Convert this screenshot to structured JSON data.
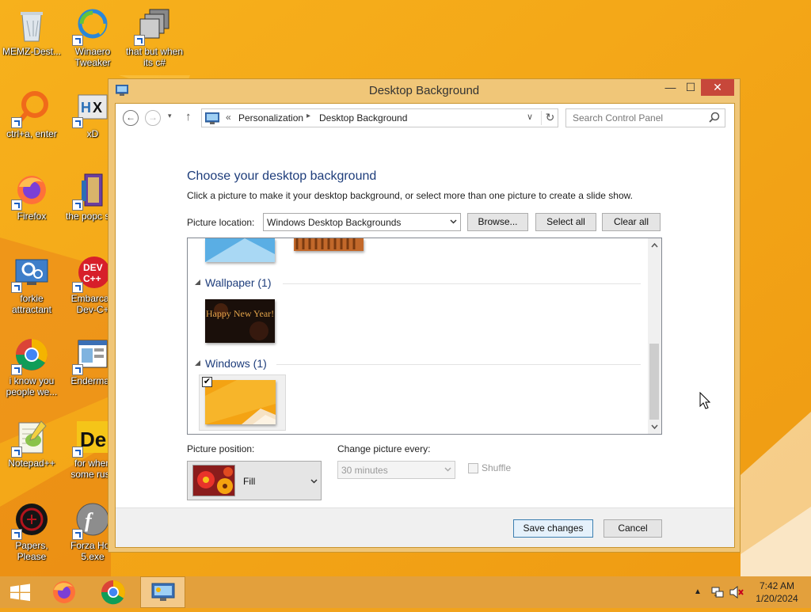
{
  "desktop": {
    "icons": [
      {
        "label": "MEMZ-Dest...",
        "icon": "recycle-bin-icon"
      },
      {
        "label": "Winaero Tweaker",
        "icon": "winaero-icon"
      },
      {
        "label": "that but when its c#",
        "icon": "stacked-windows-icon"
      },
      {
        "label": "ctrl+a, enter",
        "icon": "orange-ring-icon"
      },
      {
        "label": "xD",
        "icon": "hxd-icon"
      },
      {
        "label": "Firefox",
        "icon": "firefox-icon"
      },
      {
        "label": "the popc shit",
        "icon": "winrar-book-icon"
      },
      {
        "label": "forkie attractant",
        "icon": "settings-monitor-icon"
      },
      {
        "label": "Embarcad Dev-C+",
        "icon": "devcpp-icon"
      },
      {
        "label": "i know you people we...",
        "icon": "chrome-icon"
      },
      {
        "label": "Enderman",
        "icon": "window-app-icon"
      },
      {
        "label": "Notepad++",
        "icon": "notepadpp-icon"
      },
      {
        "label": "for when some russ",
        "icon": "de-icon"
      },
      {
        "label": "Papers, Please",
        "icon": "papers-please-icon"
      },
      {
        "label": "Forza Hori 5.exe",
        "icon": "flash-icon"
      }
    ]
  },
  "window": {
    "title": "Desktop Background",
    "controls": {
      "minimize": "—",
      "maximize": "☐",
      "close": "✕"
    },
    "nav": {
      "back": "←",
      "forward": "→",
      "recent": "▾",
      "up": "↑",
      "address_prefix": "«",
      "crumbs": [
        "Personalization",
        "Desktop Background"
      ],
      "crumb_sep": "▸",
      "dropdown": "∨",
      "refresh": "↻",
      "search_placeholder": "Search Control Panel"
    },
    "heading": "Choose your desktop background",
    "subtext": "Click a picture to make it your desktop background, or select more than one picture to create a slide show.",
    "picture_location": {
      "label": "Picture location:",
      "value": "Windows Desktop Backgrounds",
      "buttons": {
        "browse": "Browse...",
        "select_all": "Select all",
        "clear_all": "Clear all"
      }
    },
    "groups": [
      {
        "title": "Wallpaper (1)",
        "thumbs": [
          {
            "text": "Happy New Year!",
            "selected": false
          }
        ]
      },
      {
        "title": "Windows (1)",
        "thumbs": [
          {
            "text": "",
            "selected": true
          }
        ]
      }
    ],
    "checkmark": "✔",
    "picture_position": {
      "label": "Picture position:",
      "value": "Fill"
    },
    "change_every": {
      "label": "Change picture every:",
      "value": "30 minutes"
    },
    "shuffle": {
      "label": "Shuffle",
      "checked": false
    },
    "footer": {
      "save": "Save changes",
      "cancel": "Cancel"
    }
  },
  "taskbar": {
    "items": [
      "start-icon",
      "firefox-icon",
      "chrome-icon",
      "control-panel-icon"
    ],
    "tray": {
      "chevron": "▲"
    },
    "clock": {
      "time": "7:42 AM",
      "date": "1/20/2024"
    }
  },
  "colors": {
    "wallpaper_orange": "#f2a31b",
    "window_frame": "#f0c678",
    "close_red": "#c7473a",
    "heading_blue": "#1e3d7b",
    "taskbar": "#e3a03c"
  }
}
